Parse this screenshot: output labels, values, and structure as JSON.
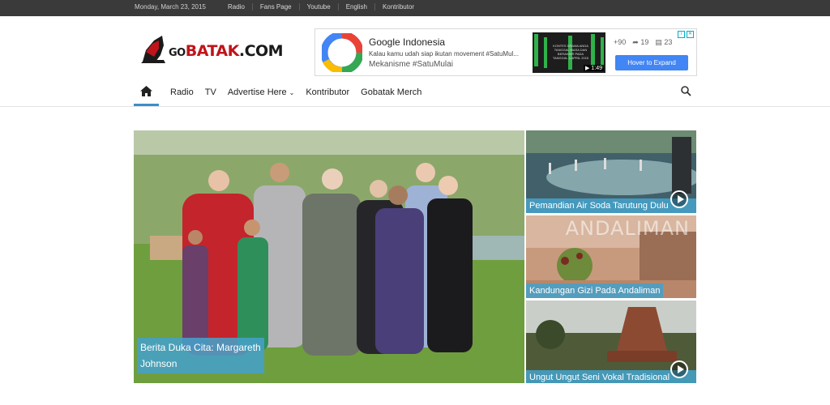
{
  "topbar": {
    "date": "Monday, March 23, 2015",
    "links": [
      "Radio",
      "Fans Page",
      "Youtube",
      "English",
      "Kontributor"
    ]
  },
  "logo": {
    "go": "GO",
    "batak": "BATAK",
    "com": ".COM"
  },
  "ad": {
    "title": "Google Indonesia",
    "description": "Kalau kamu udah siap ikutan movement #SatuMul...",
    "hashtag": "Mekanisme #SatuMulai",
    "video_duration": "1:49",
    "video_text": "KONTES DRAMA ANDA TANGGAL MASA DAN BERAKHIR PADA TANGGAL 4 APRIL 2015",
    "plus_count": "+90",
    "share_count": "19",
    "comment_count": "23",
    "expand_label": "Hover to Expand"
  },
  "nav": {
    "items": [
      "Radio",
      "TV",
      "Advertise Here",
      "Kontributor",
      "Gobatak Merch"
    ]
  },
  "featured": {
    "caption_line1": "Berita Duka Cita: Margareth",
    "caption_line2": "Johnson"
  },
  "side_posts": [
    {
      "title": "Pemandian Air Soda Tarutung Dulu Dan..."
    },
    {
      "title": "Kandungan Gizi Pada Andaliman",
      "overlay_text": "ANDALIMAN"
    },
    {
      "title": "Ungut Ungut Seni Vokal Tradisional Tapanuli..."
    }
  ],
  "colors": {
    "accent": "#3b8fc9",
    "brand_red": "#c0141b",
    "caption_bg": "#46a0c8"
  }
}
